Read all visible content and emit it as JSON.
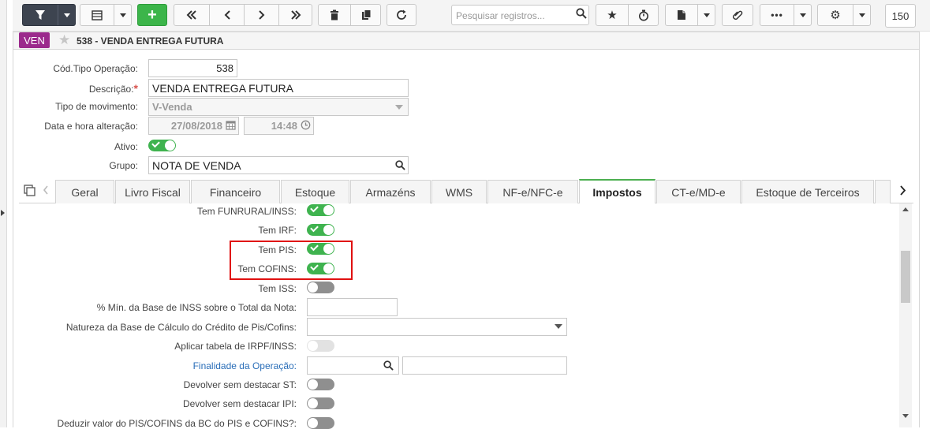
{
  "toolbar": {
    "search_placeholder": "Pesquisar registros...",
    "page_size": "150"
  },
  "header": {
    "badge": "VEN",
    "title": "538 - VENDA ENTREGA FUTURA"
  },
  "form": {
    "cod_label": "Cód.Tipo Operação:",
    "cod_value": "538",
    "desc_label": "Descrição:",
    "desc_value": "VENDA ENTREGA FUTURA",
    "tipo_label": "Tipo de movimento:",
    "tipo_value": "V-Venda",
    "data_label": "Data e hora alteração:",
    "data_value": "27/08/2018",
    "hora_value": "14:48",
    "ativo_label": "Ativo:",
    "grupo_label": "Grupo:",
    "grupo_value": "NOTA DE VENDA"
  },
  "tabs": [
    {
      "label": "Geral"
    },
    {
      "label": "Livro Fiscal"
    },
    {
      "label": "Financeiro"
    },
    {
      "label": "Estoque"
    },
    {
      "label": "Armazéns"
    },
    {
      "label": "WMS"
    },
    {
      "label": "NF-e/NFC-e"
    },
    {
      "label": "Impostos"
    },
    {
      "label": "CT-e/MD-e"
    },
    {
      "label": "Estoque de Terceiros"
    }
  ],
  "active_tab": "Impostos",
  "impostos": {
    "funrural_label": "Tem FUNRURAL/INSS:",
    "irf_label": "Tem IRF:",
    "pis_label": "Tem PIS:",
    "cofins_label": "Tem COFINS:",
    "iss_label": "Tem ISS:",
    "min_base_label": "% Mín. da Base de INSS sobre o Total da Nota:",
    "natureza_label": "Natureza da Base de Cálculo do Crédito de Pis/Cofins:",
    "irpf_label": "Aplicar tabela de IRPF/INSS:",
    "finalidade_label": "Finalidade da Operação:",
    "devolver_st_label": "Devolver sem destacar ST:",
    "devolver_ipi_label": "Devolver sem destacar IPI:",
    "deduzir_label": "Deduzir valor do PIS/COFINS da BC do PIS e COFINS?:"
  },
  "colors": {
    "toggle_on": "#3fb34f",
    "badge": "#9b2a8c",
    "highlight": "#e01010",
    "active_tab": "#4caf50"
  }
}
